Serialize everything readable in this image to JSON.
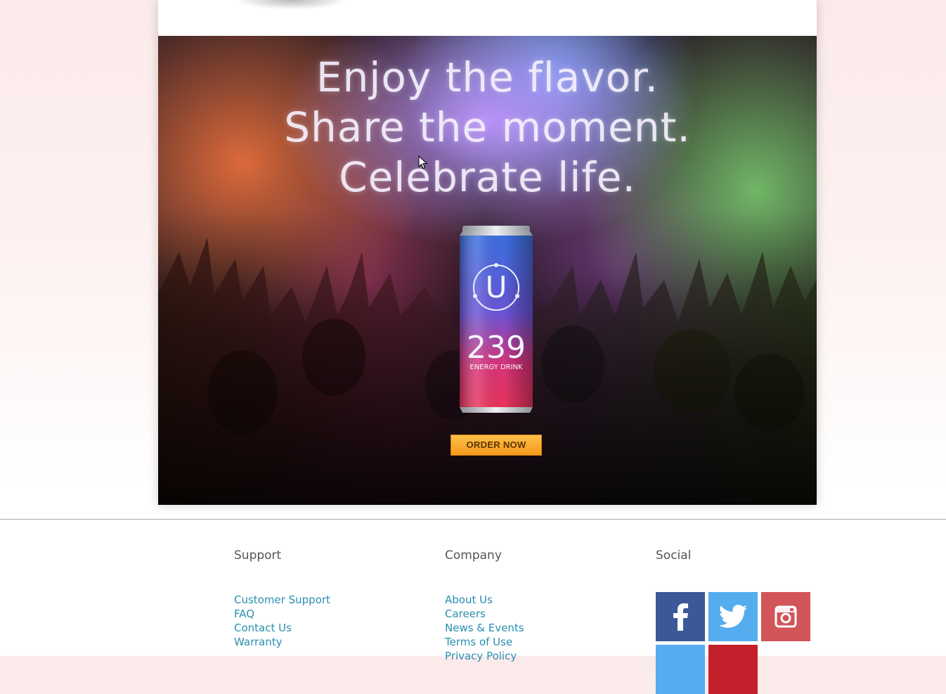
{
  "hero": {
    "headline_lines": [
      "Enjoy the flavor.",
      "Share the moment.",
      "Celebrate life."
    ],
    "product": {
      "brand_letter": "U",
      "number": "239",
      "subtitle": "ENERGY DRINK"
    },
    "order_button": "ORDER NOW"
  },
  "footer": {
    "columns": [
      {
        "title": "Support",
        "links": [
          "Customer Support",
          "FAQ",
          "Contact Us",
          "Warranty"
        ]
      },
      {
        "title": "Company",
        "links": [
          "About Us",
          "Careers",
          "News & Events",
          "Terms of Use",
          "Privacy Policy"
        ]
      },
      {
        "title": "Social",
        "icons": [
          "facebook-icon",
          "twitter-icon",
          "instagram-icon",
          "social-tile",
          "social-tile"
        ]
      }
    ]
  },
  "colors": {
    "link": "#2a8fb0",
    "order_button": "#f59a1c",
    "facebook": "#3b5998",
    "twitter": "#55acee",
    "instagram": "#d2555a"
  }
}
